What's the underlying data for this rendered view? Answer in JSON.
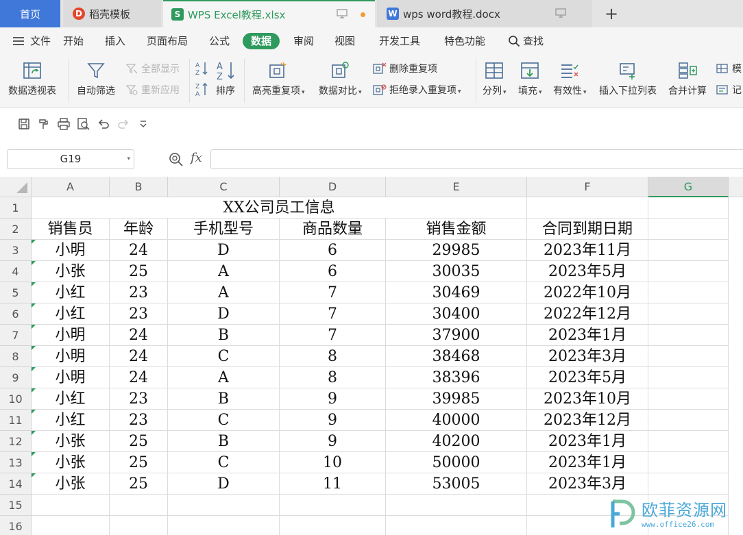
{
  "tabs": {
    "home": "首页",
    "docer": "稻壳模板",
    "excel": "WPS Excel教程.xlsx",
    "word": "wps word教程.docx",
    "add": "+"
  },
  "menu": {
    "file": "文件",
    "items": [
      "开始",
      "插入",
      "页面布局",
      "公式",
      "数据",
      "审阅",
      "视图",
      "开发工具",
      "特色功能"
    ],
    "active": "数据",
    "search": "查找"
  },
  "ribbon": {
    "pivot": "数据透视表",
    "autofilter": "自动筛选",
    "show_all": "全部显示",
    "reapply": "重新应用",
    "sort": "排序",
    "highlight_dup": "高亮重复项",
    "compare": "数据对比",
    "remove_dup": "删除重复项",
    "reject_dup": "拒绝录入重复项",
    "split": "分列",
    "fill": "填充",
    "validity": "有效性",
    "insert_dropdown": "插入下拉列表",
    "merge_calc": "合并计算",
    "mock": "模",
    "record": "记"
  },
  "formula_bar": {
    "name_box": "G19",
    "fx": "fx",
    "value": ""
  },
  "sheet": {
    "columns": [
      "A",
      "B",
      "C",
      "D",
      "E",
      "F",
      "G"
    ],
    "selected_column": "G",
    "rows": [
      "1",
      "2",
      "3",
      "4",
      "5",
      "6",
      "7",
      "8",
      "9",
      "10",
      "11",
      "12",
      "13",
      "14",
      "15",
      "16"
    ],
    "title": "XX公司员工信息",
    "headers": [
      "销售员",
      "年龄",
      "手机型号",
      "商品数量",
      "销售金额",
      "合同到期日期"
    ],
    "data": [
      [
        "小明",
        "24",
        "D",
        "6",
        "29985",
        "2023年11月"
      ],
      [
        "小张",
        "25",
        "A",
        "6",
        "30035",
        "2023年5月"
      ],
      [
        "小红",
        "23",
        "A",
        "7",
        "30469",
        "2022年10月"
      ],
      [
        "小红",
        "23",
        "D",
        "7",
        "30400",
        "2022年12月"
      ],
      [
        "小明",
        "24",
        "B",
        "7",
        "37900",
        "2023年1月"
      ],
      [
        "小明",
        "24",
        "C",
        "8",
        "38468",
        "2023年3月"
      ],
      [
        "小明",
        "24",
        "A",
        "8",
        "38396",
        "2023年5月"
      ],
      [
        "小红",
        "23",
        "B",
        "9",
        "39985",
        "2023年10月"
      ],
      [
        "小红",
        "23",
        "C",
        "9",
        "40000",
        "2023年12月"
      ],
      [
        "小张",
        "25",
        "B",
        "9",
        "40200",
        "2023年1月"
      ],
      [
        "小张",
        "25",
        "C",
        "10",
        "50000",
        "2023年1月"
      ],
      [
        "小张",
        "25",
        "D",
        "11",
        "53005",
        "2023年3月"
      ]
    ]
  },
  "watermark": {
    "title": "欧菲资源网",
    "url": "www.office26.com"
  },
  "colors": {
    "accent_green": "#2f9a5d",
    "home_tab_blue": "#3f78d8",
    "watermark_blue": "#4aa8d8"
  }
}
